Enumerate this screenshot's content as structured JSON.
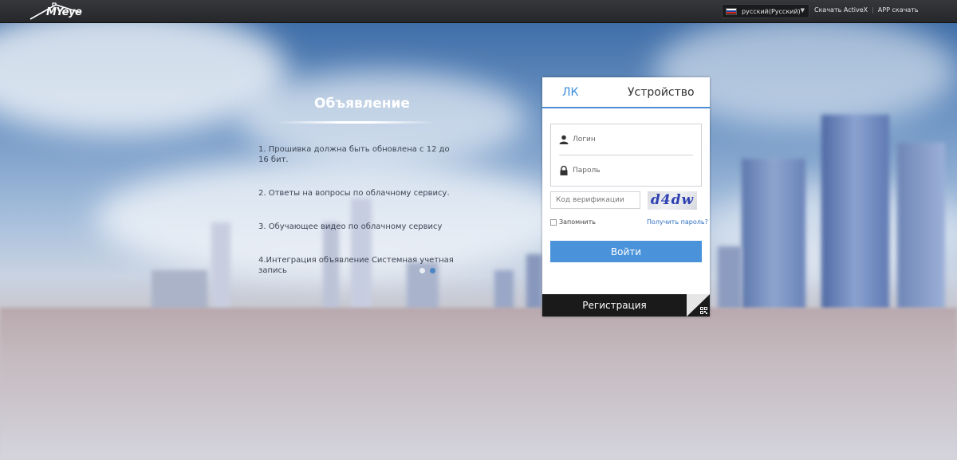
{
  "header": {
    "logo_text": "MYeye",
    "language": "русский(Русский)",
    "links": [
      "Скачать ActiveX",
      "APP скачать"
    ]
  },
  "announcement": {
    "title": "Объявление",
    "items": [
      "1. Прошивка должна быть обновлена с 12 до 16 бит.",
      "2. Ответы на вопросы по облачному сервису.",
      "3. Обучающее видео по облачному сервису",
      "4.Интеграция объявление Системная учетная запись"
    ],
    "carousel": {
      "count": 2,
      "active_index": 1
    }
  },
  "login": {
    "tabs": [
      {
        "label": "ЛК",
        "active": true
      },
      {
        "label": "Устройство",
        "active": false
      }
    ],
    "username_placeholder": "Логин",
    "password_placeholder": "Пароль",
    "verify_placeholder": "Код верификации",
    "captcha_text": "d4dw",
    "remember_label": "Запомнить",
    "forgot_label": "Получить пароль?",
    "login_button": "Войти",
    "register_label": "Регистрация"
  },
  "colors": {
    "accent": "#4a93db",
    "tab_active": "#3c8dde",
    "topbar": "#2b2d30",
    "register_bar": "#1a1a1a"
  },
  "icons": [
    "logo-house-icon",
    "russia-flag-icon",
    "caret-down-icon",
    "user-icon",
    "lock-icon",
    "qr-code-icon"
  ]
}
